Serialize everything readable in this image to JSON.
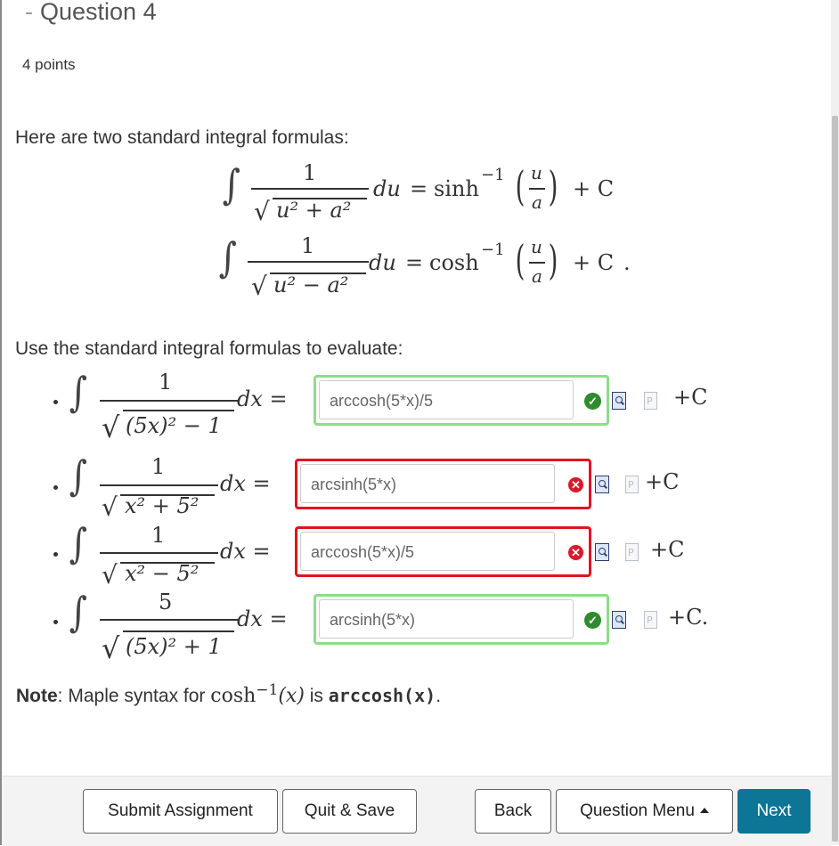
{
  "question": {
    "dash": "-",
    "title": "Question 4",
    "points": "4 points"
  },
  "intro_text": "Here are two standard integral formulas:",
  "formulas": [
    {
      "numerator": "1",
      "radicand": "u² + a²",
      "differential": "du",
      "result_fn": "sinh",
      "result_exp": "−1",
      "arg_num": "u",
      "arg_den": "a",
      "constant": "+ C",
      "tail": ""
    },
    {
      "numerator": "1",
      "radicand": "u² − a²",
      "differential": "du",
      "result_fn": "cosh",
      "result_exp": "−1",
      "arg_num": "u",
      "arg_den": "a",
      "constant": "+ C",
      "tail": "."
    }
  ],
  "task_text": "Use the standard integral formulas to evaluate:",
  "problems": [
    {
      "numerator": "1",
      "radicand": "(5x)² − 1",
      "differential": "dx =",
      "answer": "arccosh(5*x)/5",
      "status": "correct",
      "constant": "+C"
    },
    {
      "numerator": "1",
      "radicand": "x² + 5²",
      "differential": "dx =",
      "answer": "arcsinh(5*x)",
      "status": "incorrect",
      "constant": "+C"
    },
    {
      "numerator": "1",
      "radicand": "x² − 5²",
      "differential": "dx =",
      "answer": "arccosh(5*x)/5",
      "status": "incorrect",
      "constant": "+C"
    },
    {
      "numerator": "5",
      "radicand": "(5x)² + 1",
      "differential": "dx =",
      "answer": "arcsinh(5*x)",
      "status": "correct",
      "constant": "+C."
    }
  ],
  "note": {
    "label": "Note",
    "text_before": ": Maple syntax for ",
    "fn": "cosh",
    "exp": "−1",
    "arg": "(x)",
    "text_mid": " is ",
    "code": "arccosh(x)",
    "text_end": "."
  },
  "footer": {
    "submit_label": "Submit Assignment",
    "quit_label": "Quit & Save",
    "back_label": "Back",
    "menu_label": "Question Menu",
    "next_label": "Next"
  },
  "colors": {
    "correct_border": "#8fdc8a",
    "incorrect_border": "#e0141e",
    "correct_icon": "#2e8b2e",
    "incorrect_icon": "#d9192a",
    "next_button": "#0d7596"
  },
  "icons": {
    "correct": "check-circle-icon",
    "incorrect": "x-circle-icon",
    "preview": "preview-magnifier-icon",
    "document": "document-p-icon",
    "menu_caret": "caret-up-icon"
  }
}
